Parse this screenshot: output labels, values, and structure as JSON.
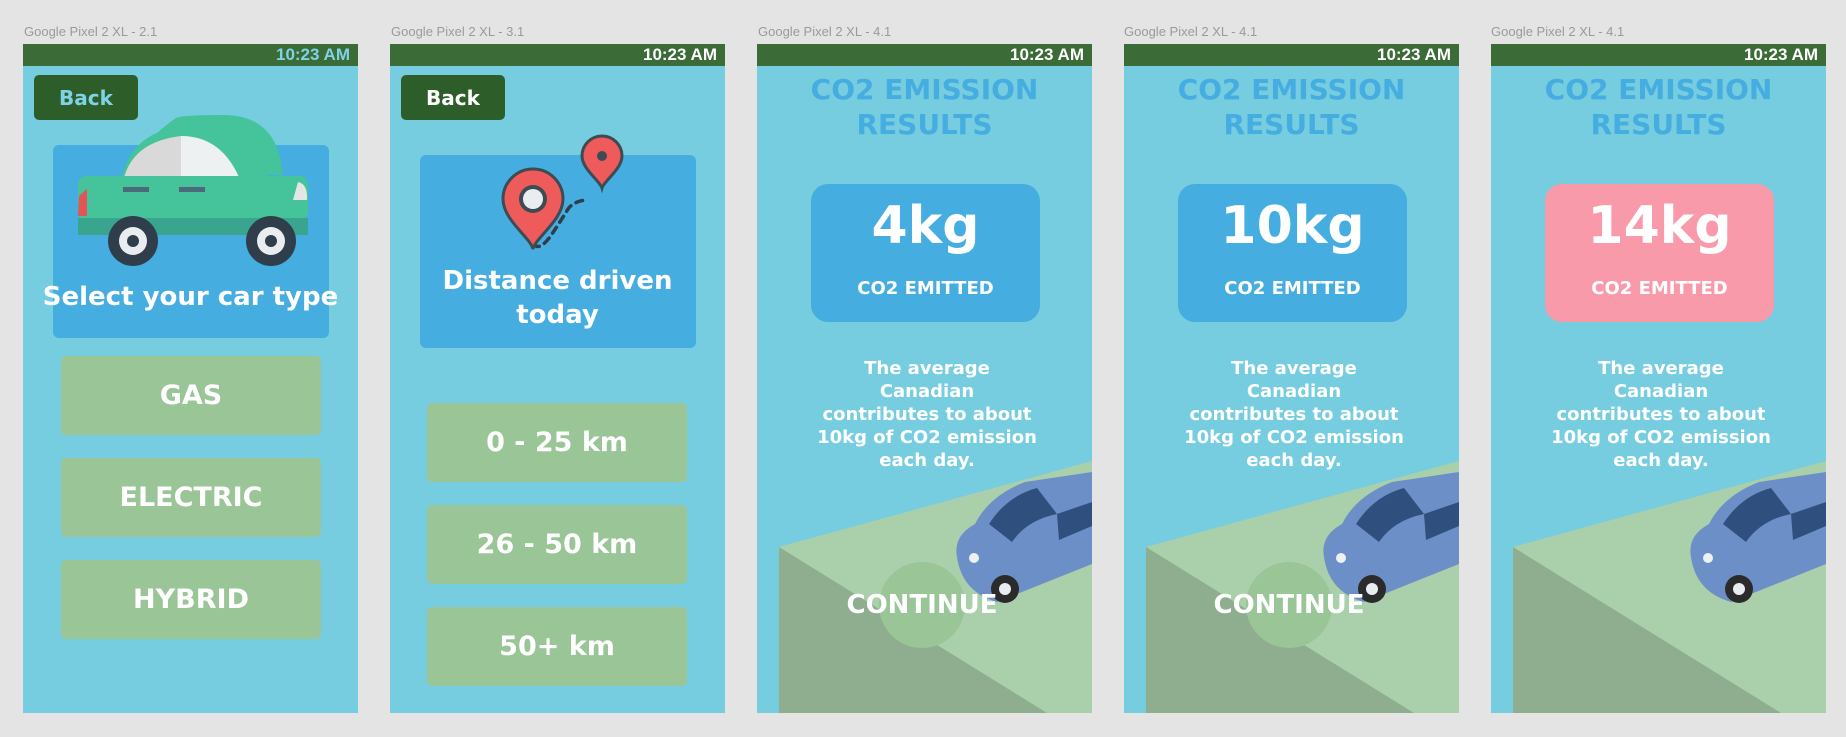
{
  "screens": [
    {
      "label": "Google Pixel 2 XL - 2.1",
      "time": "10:23 AM",
      "back": "Back",
      "title": "Select your car type",
      "options": [
        "GAS",
        "ELECTRIC",
        "HYBRID"
      ]
    },
    {
      "label": "Google Pixel 2 XL - 3.1",
      "time": "10:23 AM",
      "back": "Back",
      "title_line1": "Distance driven",
      "title_line2": "today",
      "options": [
        "0 - 25 km",
        "26 - 50 km",
        "50+ km"
      ]
    },
    {
      "label": "Google Pixel 2 XL - 4.1",
      "time": "10:23 AM",
      "title_line1": "CO2 EMISSION",
      "title_line2": "RESULTS",
      "value": "4kg",
      "emitted": "CO2 EMITTED",
      "avg": [
        "The average Canadian",
        "contributes to about",
        "10kg of CO2 emission",
        "each day."
      ],
      "continue": "CONTINUE",
      "box_color": "#45ade0"
    },
    {
      "label": "Google Pixel 2 XL - 4.1",
      "time": "10:23 AM",
      "title_line1": "CO2 EMISSION",
      "title_line2": "RESULTS",
      "value": "10kg",
      "emitted": "CO2 EMITTED",
      "avg": [
        "The average Canadian",
        "contributes to about",
        "10kg of CO2 emission",
        "each day."
      ],
      "continue": "CONTINUE",
      "box_color": "#45ade0"
    },
    {
      "label": "Google Pixel 2 XL - 4.1",
      "time": "10:23 AM",
      "title_line1": "CO2 EMISSION",
      "title_line2": "RESULTS",
      "value": "14kg",
      "emitted": "CO2 EMITTED",
      "avg": [
        "The average Canadian",
        "contributes to about",
        "10kg of CO2 emission",
        "each day."
      ],
      "box_color": "#f89aaa"
    }
  ],
  "colors": {
    "screen_bg": "#76cde0",
    "status_bar": "#3b6b37",
    "back_button": "#2d5e29",
    "card": "#45ade0",
    "option": "#9ac597",
    "high_emission": "#f89aaa"
  },
  "icons": [
    "car-icon",
    "map-pin-icon",
    "route-icon",
    "blue-car-icon"
  ]
}
